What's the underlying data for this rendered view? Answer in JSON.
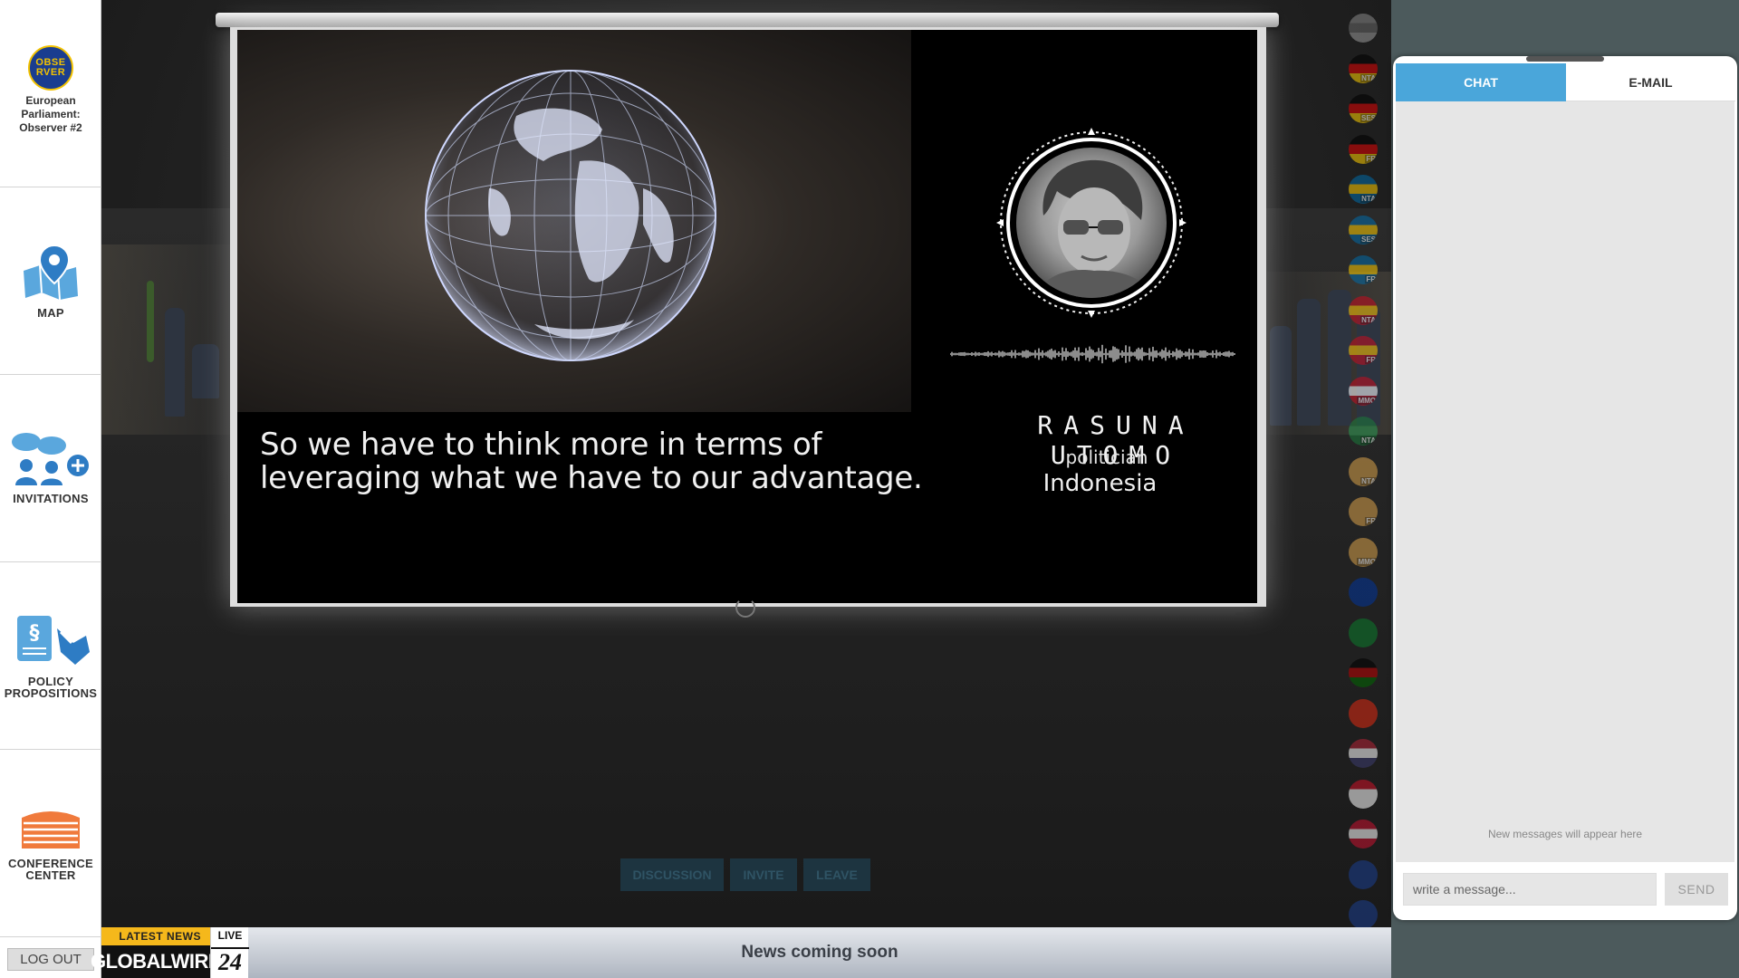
{
  "sidebar": {
    "logo": {
      "line1": "OBSE",
      "line2": "RVER",
      "caption": "European Parliament: Observer #2"
    },
    "items": [
      {
        "label": "MAP",
        "icon": "map-pin-icon"
      },
      {
        "label": "INVITATIONS",
        "icon": "invite-people-icon"
      },
      {
        "label": "POLICY PROPOSITIONS",
        "icon": "policy-document-icon"
      },
      {
        "label": "CONFERENCE CENTER",
        "icon": "conference-building-icon"
      }
    ],
    "logout_label": "LOG OUT"
  },
  "video": {
    "subtitle": "So we have to think more in terms of leveraging what we have to our advantage.",
    "speaker_name": "RASUNA UTOMO",
    "speaker_role": "politician",
    "speaker_country": "Indonesia"
  },
  "stage_buttons": [
    {
      "label": "DISCUSSION"
    },
    {
      "label": "INVITE"
    },
    {
      "label": "LEAVE"
    }
  ],
  "flags": [
    {
      "tag": "",
      "colors": [
        "#888",
        "#666",
        "#999"
      ]
    },
    {
      "tag": "NTA",
      "colors": [
        "#000",
        "#d00",
        "#ffce00"
      ]
    },
    {
      "tag": "SES",
      "colors": [
        "#000",
        "#d00",
        "#ffce00"
      ]
    },
    {
      "tag": "FR",
      "colors": [
        "#000",
        "#d00",
        "#ffce00"
      ]
    },
    {
      "tag": "NTA",
      "colors": [
        "#006aa7",
        "#fecc00",
        "#006aa7"
      ]
    },
    {
      "tag": "SES",
      "colors": [
        "#006aa7",
        "#fecc00",
        "#006aa7"
      ]
    },
    {
      "tag": "FR",
      "colors": [
        "#006aa7",
        "#fecc00",
        "#006aa7"
      ]
    },
    {
      "tag": "NTA",
      "colors": [
        "#c60b1e",
        "#ffc400",
        "#c60b1e"
      ]
    },
    {
      "tag": "FR",
      "colors": [
        "#c60b1e",
        "#ffc400",
        "#c60b1e"
      ]
    },
    {
      "tag": "MMO",
      "colors": [
        "#c60b1e",
        "#fff",
        "#c60b1e"
      ]
    },
    {
      "tag": "NTA",
      "colors": [
        "#1a7a3a",
        "#2b9a52",
        "#1a7a3a"
      ]
    },
    {
      "tag": "NTA",
      "colors": [
        "#d9a24a",
        "#d9a24a",
        "#d9a24a"
      ]
    },
    {
      "tag": "FR",
      "colors": [
        "#d9a24a",
        "#d9a24a",
        "#d9a24a"
      ]
    },
    {
      "tag": "MMO",
      "colors": [
        "#d9a24a",
        "#d9a24a",
        "#d9a24a"
      ]
    },
    {
      "tag": "",
      "colors": [
        "#003399",
        "#003399",
        "#003399"
      ]
    },
    {
      "tag": "",
      "colors": [
        "#0a7a2a",
        "#0a7a2a",
        "#0a7a2a"
      ]
    },
    {
      "tag": "",
      "colors": [
        "#000",
        "#bb0000",
        "#006600"
      ]
    },
    {
      "tag": "",
      "colors": [
        "#de2910",
        "#de2910",
        "#de2910"
      ]
    },
    {
      "tag": "",
      "colors": [
        "#b22234",
        "#fff",
        "#3c3b6e"
      ]
    },
    {
      "tag": "",
      "colors": [
        "#ce1126",
        "#fff",
        "#fff"
      ]
    },
    {
      "tag": "",
      "colors": [
        "#c8102e",
        "#fff",
        "#c8102e"
      ]
    },
    {
      "tag": "",
      "colors": [
        "#1a3d8f",
        "#1a3d8f",
        "#1a3d8f"
      ]
    },
    {
      "tag": "",
      "colors": [
        "#1a3d8f",
        "#1a3d8f",
        "#1a3d8f"
      ]
    }
  ],
  "newsbar": {
    "latest_label": "LATEST NEWS",
    "brand": "GLOBALWIRE",
    "live_label": "LIVE",
    "live_number": "24",
    "headline": "News coming soon"
  },
  "chat": {
    "tab_chat": "CHAT",
    "tab_email": "E-MAIL",
    "empty_text": "New messages will appear here",
    "input_placeholder": "write a message...",
    "send_label": "SEND"
  }
}
